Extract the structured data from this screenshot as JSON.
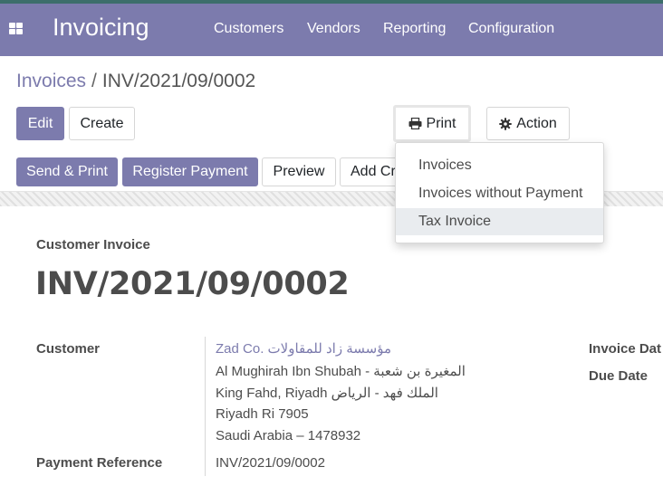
{
  "navbar": {
    "app_title": "Invoicing",
    "menu": [
      "Customers",
      "Vendors",
      "Reporting",
      "Configuration"
    ]
  },
  "breadcrumb": {
    "parent": "Invoices",
    "separator": "/",
    "current": "INV/2021/09/0002"
  },
  "control_panel": {
    "edit": "Edit",
    "create": "Create",
    "print": "Print",
    "action": "Action"
  },
  "statusbar": {
    "send_print": "Send & Print",
    "register_payment": "Register Payment",
    "preview": "Preview",
    "add_credit": "Add Cr"
  },
  "print_menu": {
    "items": [
      "Invoices",
      "Invoices without Payment",
      "Tax Invoice"
    ],
    "highlighted_index": 2
  },
  "document": {
    "subtitle": "Customer Invoice",
    "number": "INV/2021/09/0002",
    "customer_label": "Customer",
    "customer_name": "Zad Co. مؤسسة زاد للمقاولات",
    "address_lines": [
      "Al Mughirah Ibn Shubah - المغيرة بن شعبة",
      "King Fahd, Riyadh الملك فهد - الرياض",
      "Riyadh Ri 7905",
      "Saudi Arabia – 1478932"
    ],
    "payment_reference_label": "Payment Reference",
    "payment_reference": "INV/2021/09/0002",
    "invoice_date_label": "Invoice Dat",
    "due_date_label": "Due Date"
  },
  "colors": {
    "brand": "#7c7bad",
    "topbar_accent": "#3c6e6b",
    "hover_bg": "#e9ecef"
  }
}
